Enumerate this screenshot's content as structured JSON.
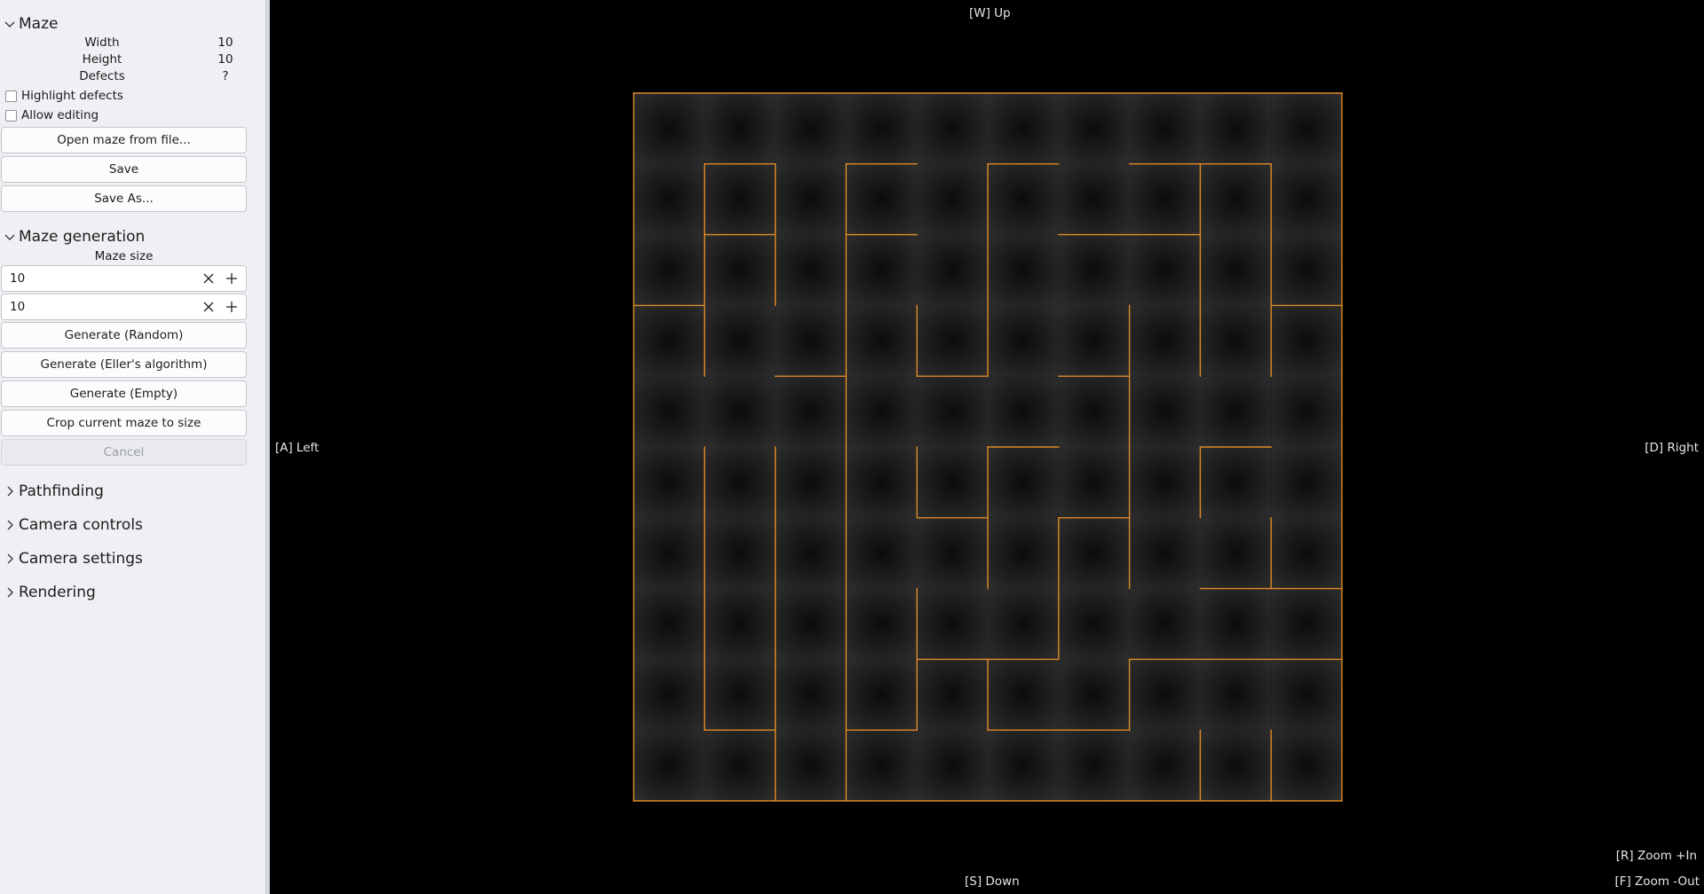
{
  "sidebar": {
    "maze": {
      "title": "Maze",
      "props": [
        {
          "label": "Width",
          "value": "10"
        },
        {
          "label": "Height",
          "value": "10"
        },
        {
          "label": "Defects",
          "value": "?"
        }
      ],
      "highlight_defects": "Highlight defects",
      "allow_editing": "Allow editing",
      "open_button": "Open maze from file...",
      "save_button": "Save",
      "save_as_button": "Save As..."
    },
    "generation": {
      "title": "Maze generation",
      "size_label": "Maze size",
      "size_width": "10",
      "size_height": "10",
      "random_button": "Generate (Random)",
      "eller_button": "Generate (Eller's algorithm)",
      "empty_button": "Generate (Empty)",
      "crop_button": "Crop current maze to size",
      "cancel_button": "Cancel"
    },
    "pathfinding": "Pathfinding",
    "camera_controls": "Camera controls",
    "camera_settings": "Camera settings",
    "rendering": "Rendering"
  },
  "viewport": {
    "up": "[W] Up",
    "down": "[S] Down",
    "left": "[A] Left",
    "right": "[D] Right",
    "zoom_in": "[R] Zoom +In",
    "zoom_out": "[F] Zoom -Out"
  },
  "maze": {
    "cols": 10,
    "rows": 10,
    "wall_color": "#e08a26",
    "horizontal_walls": [
      [
        1,
        1
      ],
      [
        3,
        1
      ],
      [
        5,
        1
      ],
      [
        7,
        1
      ],
      [
        8,
        1
      ],
      [
        1,
        2
      ],
      [
        3,
        2
      ],
      [
        6,
        2
      ],
      [
        7,
        2
      ],
      [
        0,
        3
      ],
      [
        9,
        3
      ],
      [
        2,
        4
      ],
      [
        4,
        4
      ],
      [
        6,
        4
      ],
      [
        5,
        5
      ],
      [
        8,
        5
      ],
      [
        4,
        6
      ],
      [
        6,
        6
      ],
      [
        8,
        7
      ],
      [
        9,
        7
      ],
      [
        4,
        8
      ],
      [
        5,
        8
      ],
      [
        7,
        8
      ],
      [
        8,
        8
      ],
      [
        9,
        8
      ],
      [
        1,
        9
      ],
      [
        3,
        9
      ],
      [
        5,
        9
      ],
      [
        6,
        9
      ]
    ],
    "vertical_walls": [
      [
        1,
        1
      ],
      [
        2,
        1
      ],
      [
        3,
        1
      ],
      [
        5,
        1
      ],
      [
        8,
        1
      ],
      [
        9,
        1
      ],
      [
        1,
        2
      ],
      [
        2,
        2
      ],
      [
        3,
        2
      ],
      [
        5,
        2
      ],
      [
        8,
        2
      ],
      [
        9,
        2
      ],
      [
        1,
        3
      ],
      [
        3,
        3
      ],
      [
        4,
        3
      ],
      [
        5,
        3
      ],
      [
        7,
        3
      ],
      [
        8,
        3
      ],
      [
        9,
        3
      ],
      [
        3,
        4
      ],
      [
        7,
        4
      ],
      [
        1,
        5
      ],
      [
        2,
        5
      ],
      [
        3,
        5
      ],
      [
        4,
        5
      ],
      [
        5,
        5
      ],
      [
        7,
        5
      ],
      [
        8,
        5
      ],
      [
        1,
        6
      ],
      [
        2,
        6
      ],
      [
        3,
        6
      ],
      [
        5,
        6
      ],
      [
        6,
        6
      ],
      [
        7,
        6
      ],
      [
        9,
        6
      ],
      [
        1,
        7
      ],
      [
        2,
        7
      ],
      [
        3,
        7
      ],
      [
        4,
        7
      ],
      [
        6,
        7
      ],
      [
        1,
        8
      ],
      [
        2,
        8
      ],
      [
        3,
        8
      ],
      [
        4,
        8
      ],
      [
        5,
        8
      ],
      [
        7,
        8
      ],
      [
        2,
        9
      ],
      [
        3,
        9
      ],
      [
        8,
        9
      ],
      [
        9,
        9
      ]
    ]
  }
}
